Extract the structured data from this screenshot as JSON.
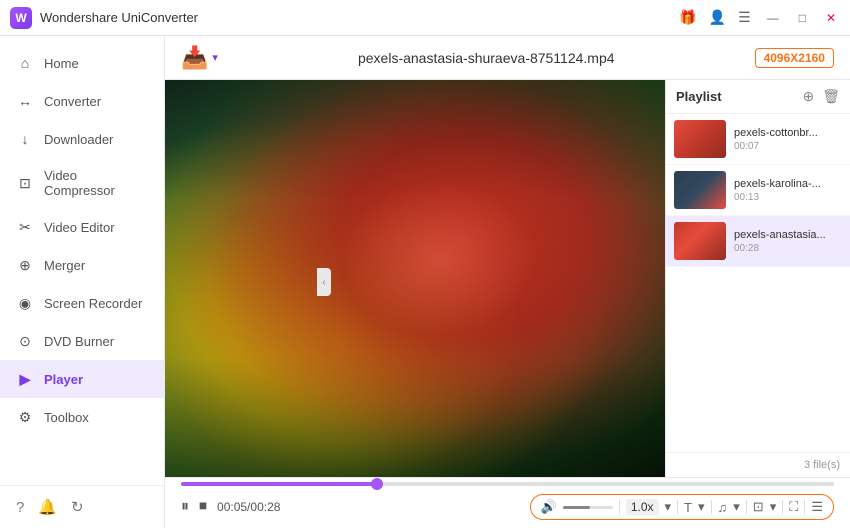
{
  "app": {
    "title": "Wondershare UniConverter",
    "logo_text": "W"
  },
  "titlebar": {
    "icons": [
      "gift-icon",
      "user-icon",
      "menu-icon",
      "minimize-icon",
      "maximize-icon",
      "close-icon"
    ],
    "win_min": "—",
    "win_max": "□",
    "win_close": "✕"
  },
  "sidebar": {
    "items": [
      {
        "id": "home",
        "label": "Home",
        "icon": "⌂"
      },
      {
        "id": "converter",
        "label": "Converter",
        "icon": "↔"
      },
      {
        "id": "downloader",
        "label": "Downloader",
        "icon": "↓"
      },
      {
        "id": "video-compressor",
        "label": "Video Compressor",
        "icon": "⊡"
      },
      {
        "id": "video-editor",
        "label": "Video Editor",
        "icon": "✂"
      },
      {
        "id": "merger",
        "label": "Merger",
        "icon": "⊕"
      },
      {
        "id": "screen-recorder",
        "label": "Screen Recorder",
        "icon": "◉"
      },
      {
        "id": "dvd-burner",
        "label": "DVD Burner",
        "icon": "⊙"
      },
      {
        "id": "player",
        "label": "Player",
        "icon": "▶",
        "active": true
      },
      {
        "id": "toolbox",
        "label": "Toolbox",
        "icon": "⚙"
      }
    ],
    "bottom_icons": [
      "help-icon",
      "bell-icon",
      "refresh-icon"
    ]
  },
  "topbar": {
    "add_btn_label": "📥",
    "file_name": "pexels-anastasia-shuraeva-8751124.mp4",
    "resolution": "4096X2160"
  },
  "playlist": {
    "title": "Playlist",
    "file_count": "3 file(s)",
    "items": [
      {
        "id": 1,
        "name": "pexels-cottonbr...",
        "duration": "00:07",
        "thumb_class": "thumb-1"
      },
      {
        "id": 2,
        "name": "pexels-karolina-...",
        "duration": "00:13",
        "thumb_class": "thumb-2"
      },
      {
        "id": 3,
        "name": "pexels-anastasia...",
        "duration": "00:28",
        "thumb_class": "thumb-3",
        "active": true
      }
    ]
  },
  "player": {
    "current_time": "00:05",
    "total_time": "00:28",
    "time_display": "00:05/00:28",
    "progress_percent": 30,
    "speed": "1.0x"
  },
  "controls": {
    "pause_btn": "⏸",
    "stop_btn": "⏹",
    "volume_icon": "🔊",
    "speed_label": "1.0x",
    "text_icon": "T",
    "audio_icon": "♫",
    "screenshot_icon": "⊡",
    "fullscreen_icon": "⛶",
    "playlist_icon": "☰"
  }
}
